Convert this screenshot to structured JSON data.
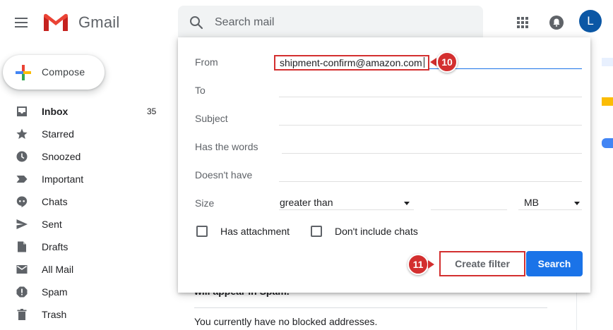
{
  "header": {
    "brand": "Gmail",
    "search_placeholder": "Search mail",
    "avatar_initial": "L"
  },
  "sidebar": {
    "compose_label": "Compose",
    "items": [
      {
        "label": "Inbox",
        "count": "35",
        "icon": "inbox-icon"
      },
      {
        "label": "Starred",
        "count": "",
        "icon": "star-icon"
      },
      {
        "label": "Snoozed",
        "count": "",
        "icon": "clock-icon"
      },
      {
        "label": "Important",
        "count": "",
        "icon": "important-icon"
      },
      {
        "label": "Chats",
        "count": "",
        "icon": "chat-icon"
      },
      {
        "label": "Sent",
        "count": "",
        "icon": "send-icon"
      },
      {
        "label": "Drafts",
        "count": "",
        "icon": "draft-icon"
      },
      {
        "label": "All Mail",
        "count": "",
        "icon": "mail-icon"
      },
      {
        "label": "Spam",
        "count": "",
        "icon": "spam-icon"
      },
      {
        "label": "Trash",
        "count": "",
        "icon": "trash-icon"
      }
    ]
  },
  "filter": {
    "from_label": "From",
    "from_value": "shipment-confirm@amazon.com",
    "to_label": "To",
    "subject_label": "Subject",
    "has_words_label": "Has the words",
    "doesnt_have_label": "Doesn't have",
    "size_label": "Size",
    "size_operator": "greater than",
    "size_unit": "MB",
    "has_attachment_label": "Has attachment",
    "dont_include_chats_label": "Don't include chats",
    "create_filter_label": "Create filter",
    "search_label": "Search"
  },
  "callouts": {
    "step_from": "10",
    "step_create": "11"
  },
  "background": {
    "spam_text": "will appear in Spam.",
    "blocked_text": "You currently have no blocked addresses."
  },
  "colors": {
    "accent": "#1a73e8",
    "callout": "#d32f2f",
    "avatar": "#0b57a5"
  }
}
